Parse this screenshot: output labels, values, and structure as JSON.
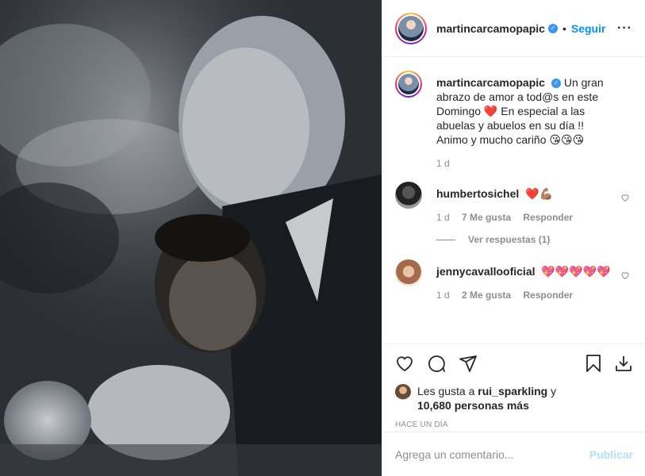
{
  "post": {
    "photo_alt": "Foto del post",
    "author": "martincarcamopapic",
    "follow_label": "Seguir",
    "more_icon": "more-options-icon"
  },
  "caption": {
    "username": "martincarcamopapic",
    "text_1": "Un gran abrazo de amor a tod@s en este Domingo ",
    "text_2": " En especial a las abuelas y abuelos en su día !! Animo y mucho cariño ",
    "kisses": "😘😘😘",
    "heart": "❤️",
    "time": "1 d"
  },
  "comments": [
    {
      "username": "humbertosichel",
      "text": "❤️💪🏽",
      "time": "1 d",
      "likes": "7 Me gusta",
      "reply_label": "Responder",
      "view_replies": "Ver respuestas (1)"
    },
    {
      "username": "jennycavallooficial",
      "text": "💖💖💖💖💖",
      "time": "1 d",
      "likes": "2 Me gusta",
      "reply_label": "Responder"
    }
  ],
  "actions": {
    "like_icon": "heart-icon",
    "comment_icon": "comment-icon",
    "share_icon": "share-icon",
    "save_icon": "bookmark-icon",
    "download_icon": "download-icon"
  },
  "likes": {
    "prefix": "Les gusta a ",
    "user": "rui_sparkling",
    "middle": " y",
    "others": "10,680 personas más"
  },
  "timestamp": "HACE UN DÍA",
  "comment_box": {
    "placeholder": "Agrega un comentario...",
    "publish_label": "Publicar"
  },
  "colors": {
    "accent": "#0095f6",
    "publish_disabled": "#b2dffc",
    "muted": "#8e8e8e",
    "text": "#262626"
  }
}
